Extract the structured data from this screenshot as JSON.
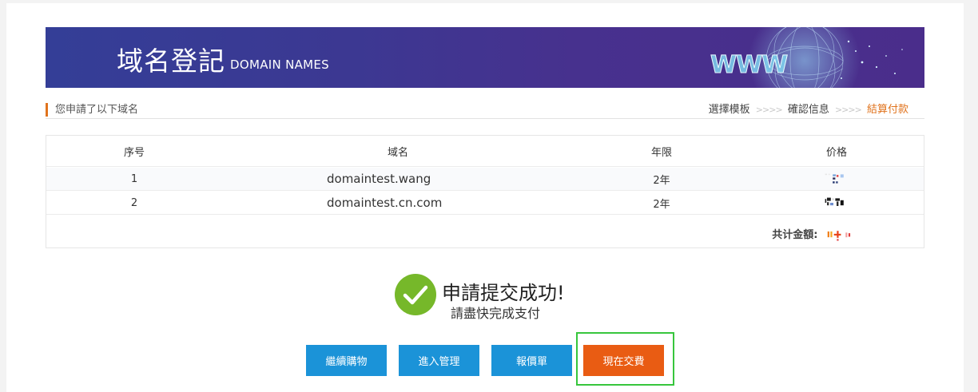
{
  "banner": {
    "title": "域名登記",
    "subtitle": "DOMAIN NAMES",
    "graphic_text": "WWW",
    "colors": {
      "gradient_start": "#343e97",
      "gradient_end": "#4a2d8b"
    }
  },
  "header": {
    "applied_label": "您申請了以下域名",
    "steps": [
      {
        "label": "選擇模板",
        "active": false
      },
      {
        "label": "確認信息",
        "active": false
      },
      {
        "label": "結算付款",
        "active": true
      }
    ],
    "step_separator": ">>>>",
    "accent_color": "#e0731d"
  },
  "order_table": {
    "columns": [
      "序号",
      "域名",
      "年限",
      "价格"
    ],
    "rows": [
      {
        "no": "1",
        "domain": "domaintest.wang",
        "years": "2年",
        "price_icon": "pixelated-redacted-price"
      },
      {
        "no": "2",
        "domain": "domaintest.cn.com",
        "years": "2年",
        "price_icon": "pixelated-redacted-price"
      }
    ],
    "total_label": "共计金額:",
    "total_icon": "pixelated-redacted-total"
  },
  "success": {
    "icon": "check-circle-icon",
    "title": "申請提交成功!",
    "subtitle": "請盡快完成支付",
    "color": "#76b82a"
  },
  "actions": {
    "continue_shopping": "繼續購物",
    "enter_management": "進入管理",
    "quotation": "報價單",
    "pay_now": "現在交費",
    "primary_color": "#1b93d8",
    "pay_color": "#e95c13",
    "highlight_color": "#37c63d"
  }
}
